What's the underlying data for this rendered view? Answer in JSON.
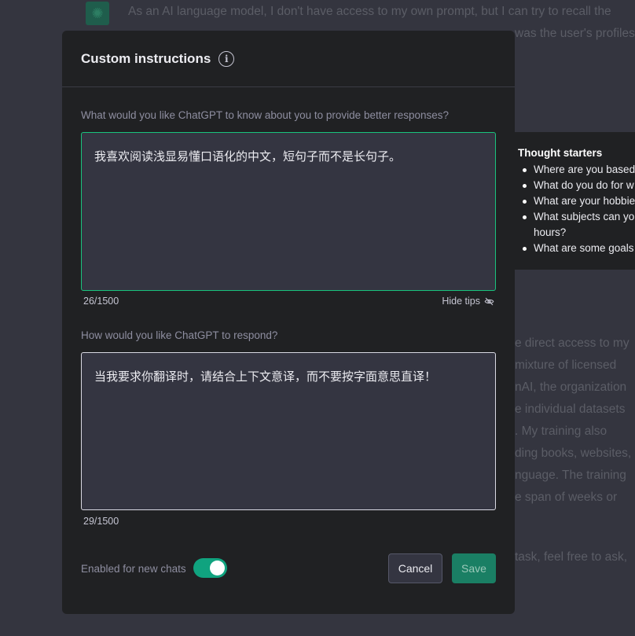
{
  "background_chat": {
    "line1": "As an AI language model, I don't have access to my own prompt, but I can try to recall the",
    "line2": "was the user's profiles",
    "right_lines": [
      "e direct access to my",
      "mixture of licensed",
      "nAI, the organization",
      "e individual datasets",
      ". My training also",
      "ding books, websites,",
      "nguage. The training",
      "e span of weeks or",
      "task, feel free to ask,"
    ]
  },
  "modal": {
    "title": "Custom instructions",
    "info_icon_glyph": "i",
    "field1": {
      "label": "What would you like ChatGPT to know about you to provide better responses?",
      "value": "我喜欢阅读浅显易懂口语化的中文，短句子而不是长句子。",
      "counter": "26/1500",
      "hide_tips": "Hide tips"
    },
    "field2": {
      "label": "How would you like ChatGPT to respond?",
      "value": "当我要求你翻译时，请结合上下文意译，而不要按字面意思直译！",
      "counter": "29/1500"
    },
    "toggle": {
      "label": "Enabled for new chats",
      "on": true
    },
    "buttons": {
      "cancel": "Cancel",
      "save": "Save"
    }
  },
  "tips": {
    "title": "Thought starters",
    "items": [
      "Where are you based",
      "What do you do for w",
      "What are your hobbie",
      "What subjects can yo hours?",
      "What are some goals"
    ]
  },
  "colors": {
    "accent_green": "#19c37d",
    "toggle_green": "#10a37f",
    "save_green": "#1a7f64",
    "modal_bg": "#202123",
    "textarea_bg": "#343541"
  }
}
